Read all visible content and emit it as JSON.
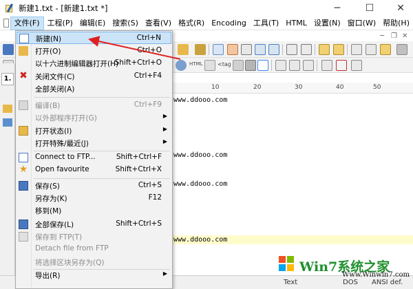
{
  "window": {
    "title": "新建1.txt - [新建1.txt *]",
    "minimize": "─",
    "maximize": "☐",
    "close": "✕"
  },
  "menubar": {
    "items": [
      {
        "label": "文件(F)"
      },
      {
        "label": "工程(P)"
      },
      {
        "label": "编辑(E)"
      },
      {
        "label": "搜索(S)"
      },
      {
        "label": "查看(V)"
      },
      {
        "label": "格式(R)"
      },
      {
        "label": "Encoding"
      },
      {
        "label": "工具(T)"
      },
      {
        "label": "HTML"
      },
      {
        "label": "设置(N)"
      },
      {
        "label": "窗口(W)"
      },
      {
        "label": "帮助(H)"
      }
    ],
    "mdi_minimize": "─",
    "mdi_restore": "❐",
    "mdi_close": "✕"
  },
  "left_panel": {
    "tab_label": "1."
  },
  "ruler": {
    "marks": [
      "10",
      "20",
      "30",
      "40",
      "50"
    ]
  },
  "editor": {
    "lines": [
      {
        "text": "www.ddooo.com",
        "highlight": false
      },
      {
        "text": "www.ddooo.com",
        "highlight": false
      },
      {
        "text": "www.ddooo.com",
        "highlight": false
      },
      {
        "text": "www.ddooo.com",
        "highlight": true
      }
    ]
  },
  "toolbar2": {
    "html_label": "HTML",
    "tag_label": "<tag"
  },
  "statusbar": {
    "text": "Text",
    "eol": "DOS",
    "encoding": "ANSI def."
  },
  "file_menu": {
    "items": [
      {
        "label": "新建(N)",
        "shortcut": "Ctrl+N",
        "disabled": false,
        "submenu": false,
        "selected": true,
        "icon": "new-file-icon"
      },
      {
        "label": "打开(O)",
        "shortcut": "Ctrl+O",
        "disabled": false,
        "submenu": false,
        "selected": false,
        "icon": "open-folder-icon"
      },
      {
        "label": "以十六进制编辑器打开(H)",
        "shortcut": "Shift+Ctrl+O",
        "disabled": false,
        "submenu": false,
        "selected": false,
        "icon": ""
      },
      {
        "label": "关闭文件(C)",
        "shortcut": "Ctrl+F4",
        "disabled": false,
        "submenu": false,
        "selected": false,
        "icon": "close-file-icon"
      },
      {
        "label": "全部关闭(A)",
        "shortcut": "",
        "disabled": false,
        "submenu": false,
        "selected": false,
        "icon": ""
      },
      {
        "label": "编译(B)",
        "shortcut": "Ctrl+F9",
        "disabled": true,
        "submenu": false,
        "selected": false,
        "icon": "compile-icon"
      },
      {
        "label": "以外部程序打开(G)",
        "shortcut": "",
        "disabled": true,
        "submenu": true,
        "selected": false,
        "icon": ""
      },
      {
        "label": "打开状态(I)",
        "shortcut": "",
        "disabled": false,
        "submenu": true,
        "selected": false,
        "icon": "open-state-icon"
      },
      {
        "label": "打开特殊/最近(J)",
        "shortcut": "",
        "disabled": false,
        "submenu": true,
        "selected": false,
        "icon": ""
      },
      {
        "label": "Connect to FTP...",
        "shortcut": "Shift+Ctrl+F",
        "disabled": false,
        "submenu": false,
        "selected": false,
        "icon": "ftp-icon"
      },
      {
        "label": "Open favourite",
        "shortcut": "Shift+Ctrl+X",
        "disabled": false,
        "submenu": false,
        "selected": false,
        "icon": "star-icon"
      },
      {
        "label": "保存(S)",
        "shortcut": "Ctrl+S",
        "disabled": false,
        "submenu": false,
        "selected": false,
        "icon": "save-icon"
      },
      {
        "label": "另存为(K)",
        "shortcut": "F12",
        "disabled": false,
        "submenu": false,
        "selected": false,
        "icon": ""
      },
      {
        "label": "移到(M)",
        "shortcut": "",
        "disabled": false,
        "submenu": false,
        "selected": false,
        "icon": ""
      },
      {
        "label": "全部保存(L)",
        "shortcut": "Shift+Ctrl+S",
        "disabled": false,
        "submenu": false,
        "selected": false,
        "icon": "save-all-icon"
      },
      {
        "label": "保存到 FTP(T)",
        "shortcut": "",
        "disabled": true,
        "submenu": false,
        "selected": false,
        "icon": "save-ftp-icon"
      },
      {
        "label": "Detach file from FTP",
        "shortcut": "",
        "disabled": true,
        "submenu": false,
        "selected": false,
        "icon": ""
      },
      {
        "label": "将选择区块另存为(Q)",
        "shortcut": "",
        "disabled": true,
        "submenu": false,
        "selected": false,
        "icon": ""
      },
      {
        "label": "导出(R)",
        "shortcut": "",
        "disabled": false,
        "submenu": true,
        "selected": false,
        "icon": ""
      }
    ]
  },
  "watermark": {
    "brand": "Win7系统之家",
    "url": "Www.Winwin7.com"
  },
  "colors": {
    "selection": "#cce4f7",
    "arrow": "#e02020",
    "highlight_line": "#fffccc"
  }
}
